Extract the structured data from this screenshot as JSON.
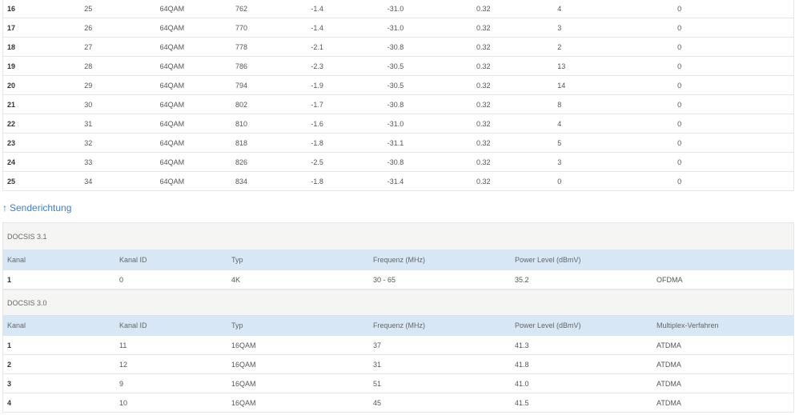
{
  "downstream": {
    "rows": [
      [
        "16",
        "25",
        "64QAM",
        "762",
        "-1.4",
        "-31.0",
        "0.32",
        "4",
        "0"
      ],
      [
        "17",
        "26",
        "64QAM",
        "770",
        "-1.4",
        "-31.0",
        "0.32",
        "3",
        "0"
      ],
      [
        "18",
        "27",
        "64QAM",
        "778",
        "-2.1",
        "-30.8",
        "0.32",
        "2",
        "0"
      ],
      [
        "19",
        "28",
        "64QAM",
        "786",
        "-2.3",
        "-30.5",
        "0.32",
        "13",
        "0"
      ],
      [
        "20",
        "29",
        "64QAM",
        "794",
        "-1.9",
        "-30.5",
        "0.32",
        "14",
        "0"
      ],
      [
        "21",
        "30",
        "64QAM",
        "802",
        "-1.7",
        "-30.8",
        "0.32",
        "8",
        "0"
      ],
      [
        "22",
        "31",
        "64QAM",
        "810",
        "-1.6",
        "-31.0",
        "0.32",
        "4",
        "0"
      ],
      [
        "23",
        "32",
        "64QAM",
        "818",
        "-1.8",
        "-31.1",
        "0.32",
        "5",
        "0"
      ],
      [
        "24",
        "33",
        "64QAM",
        "826",
        "-2.5",
        "-30.8",
        "0.32",
        "3",
        "0"
      ],
      [
        "25",
        "34",
        "64QAM",
        "834",
        "-1.8",
        "-31.4",
        "0.32",
        "0",
        "0"
      ]
    ]
  },
  "upstream": {
    "section_link": "Senderichtung",
    "docsis31": {
      "title": "DOCSIS 3.1",
      "headers": [
        "Kanal",
        "Kanal ID",
        "Typ",
        "Frequenz (MHz)",
        "Power Level (dBmV)",
        ""
      ],
      "rows": [
        [
          "1",
          "0",
          "4K",
          "30 - 65",
          "35.2",
          "OFDMA"
        ]
      ]
    },
    "docsis30": {
      "title": "DOCSIS 3.0",
      "headers": [
        "Kanal",
        "Kanal ID",
        "Typ",
        "Frequenz (MHz)",
        "Power Level (dBmV)",
        "Multiplex-Verfahren"
      ],
      "rows": [
        [
          "1",
          "11",
          "16QAM",
          "37",
          "41.3",
          "ATDMA"
        ],
        [
          "2",
          "12",
          "16QAM",
          "31",
          "41.8",
          "ATDMA"
        ],
        [
          "3",
          "9",
          "16QAM",
          "51",
          "41.0",
          "ATDMA"
        ],
        [
          "4",
          "10",
          "16QAM",
          "45",
          "41.5",
          "ATDMA"
        ]
      ]
    }
  },
  "colors": {
    "link": "#3b82c4",
    "header_bg": "#d8e7f5",
    "group_bg": "#f5f5f4"
  }
}
